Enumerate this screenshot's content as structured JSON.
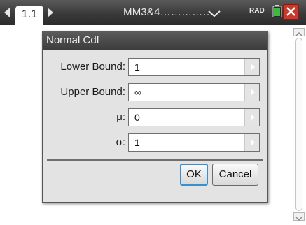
{
  "topbar": {
    "page_tab": "1.1",
    "document_title": "MM3&4……………",
    "angle_mode": "RAD",
    "icons": {
      "prev": "chevron-left-icon",
      "next": "chevron-right-icon",
      "title_menu": "chevron-down-icon",
      "battery": "battery-icon",
      "close": "close-icon"
    },
    "colors": {
      "close": "#c83a2c",
      "battery": "#3bbd3b"
    }
  },
  "dialog": {
    "title": "Normal Cdf",
    "fields": [
      {
        "label": "Lower Bound:",
        "value": "1"
      },
      {
        "label": "Upper Bound:",
        "value": "∞"
      },
      {
        "label": "μ:",
        "value": "0"
      },
      {
        "label": "σ:",
        "value": "1"
      }
    ],
    "ok_label": "OK",
    "cancel_label": "Cancel",
    "focus_color": "#3a8fd0"
  }
}
